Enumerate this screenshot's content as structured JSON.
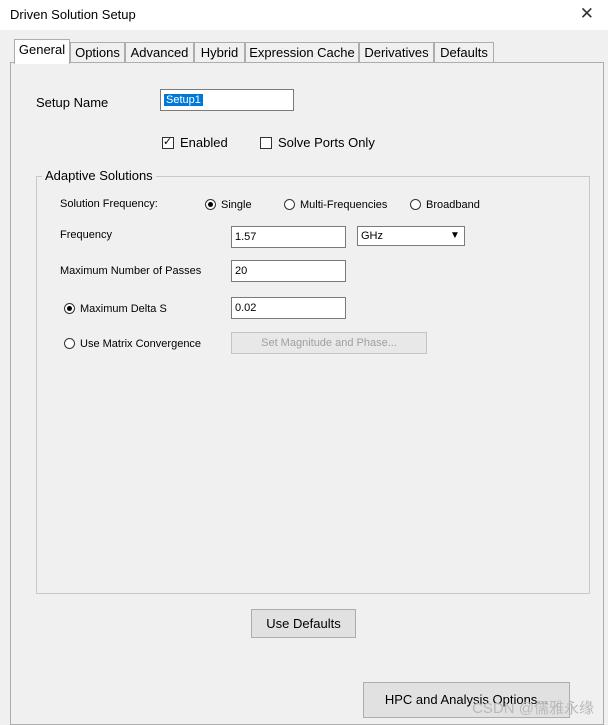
{
  "window": {
    "title": "Driven Solution Setup"
  },
  "tabs": [
    {
      "label": "General"
    },
    {
      "label": "Options"
    },
    {
      "label": "Advanced"
    },
    {
      "label": "Hybrid"
    },
    {
      "label": "Expression Cache"
    },
    {
      "label": "Derivatives"
    },
    {
      "label": "Defaults"
    }
  ],
  "active_tab": "General",
  "setup": {
    "name_label": "Setup Name",
    "name_value": "Setup1"
  },
  "enabled": {
    "label": "Enabled",
    "checked": true
  },
  "solve_ports": {
    "label": "Solve Ports Only",
    "checked": false
  },
  "adaptive": {
    "group_title": "Adaptive Solutions",
    "solution_frequency_label": "Solution Frequency:",
    "freq_options": [
      {
        "label": "Single",
        "selected": true
      },
      {
        "label": "Multi-Frequencies",
        "selected": false
      },
      {
        "label": "Broadband",
        "selected": false
      }
    ],
    "frequency_label": "Frequency",
    "frequency_value": "1.57",
    "frequency_unit": "GHz",
    "max_passes_label": "Maximum Number of Passes",
    "max_passes_value": "20",
    "max_delta_label": "Maximum Delta S",
    "max_delta_value": "0.02",
    "matrix_label": "Use Matrix Convergence",
    "magnitude_button": "Set Magnitude and Phase..."
  },
  "buttons": {
    "use_defaults": "Use Defaults",
    "hpc": "HPC and Analysis Options..."
  },
  "watermark": "CSDN @儒雅永缘"
}
